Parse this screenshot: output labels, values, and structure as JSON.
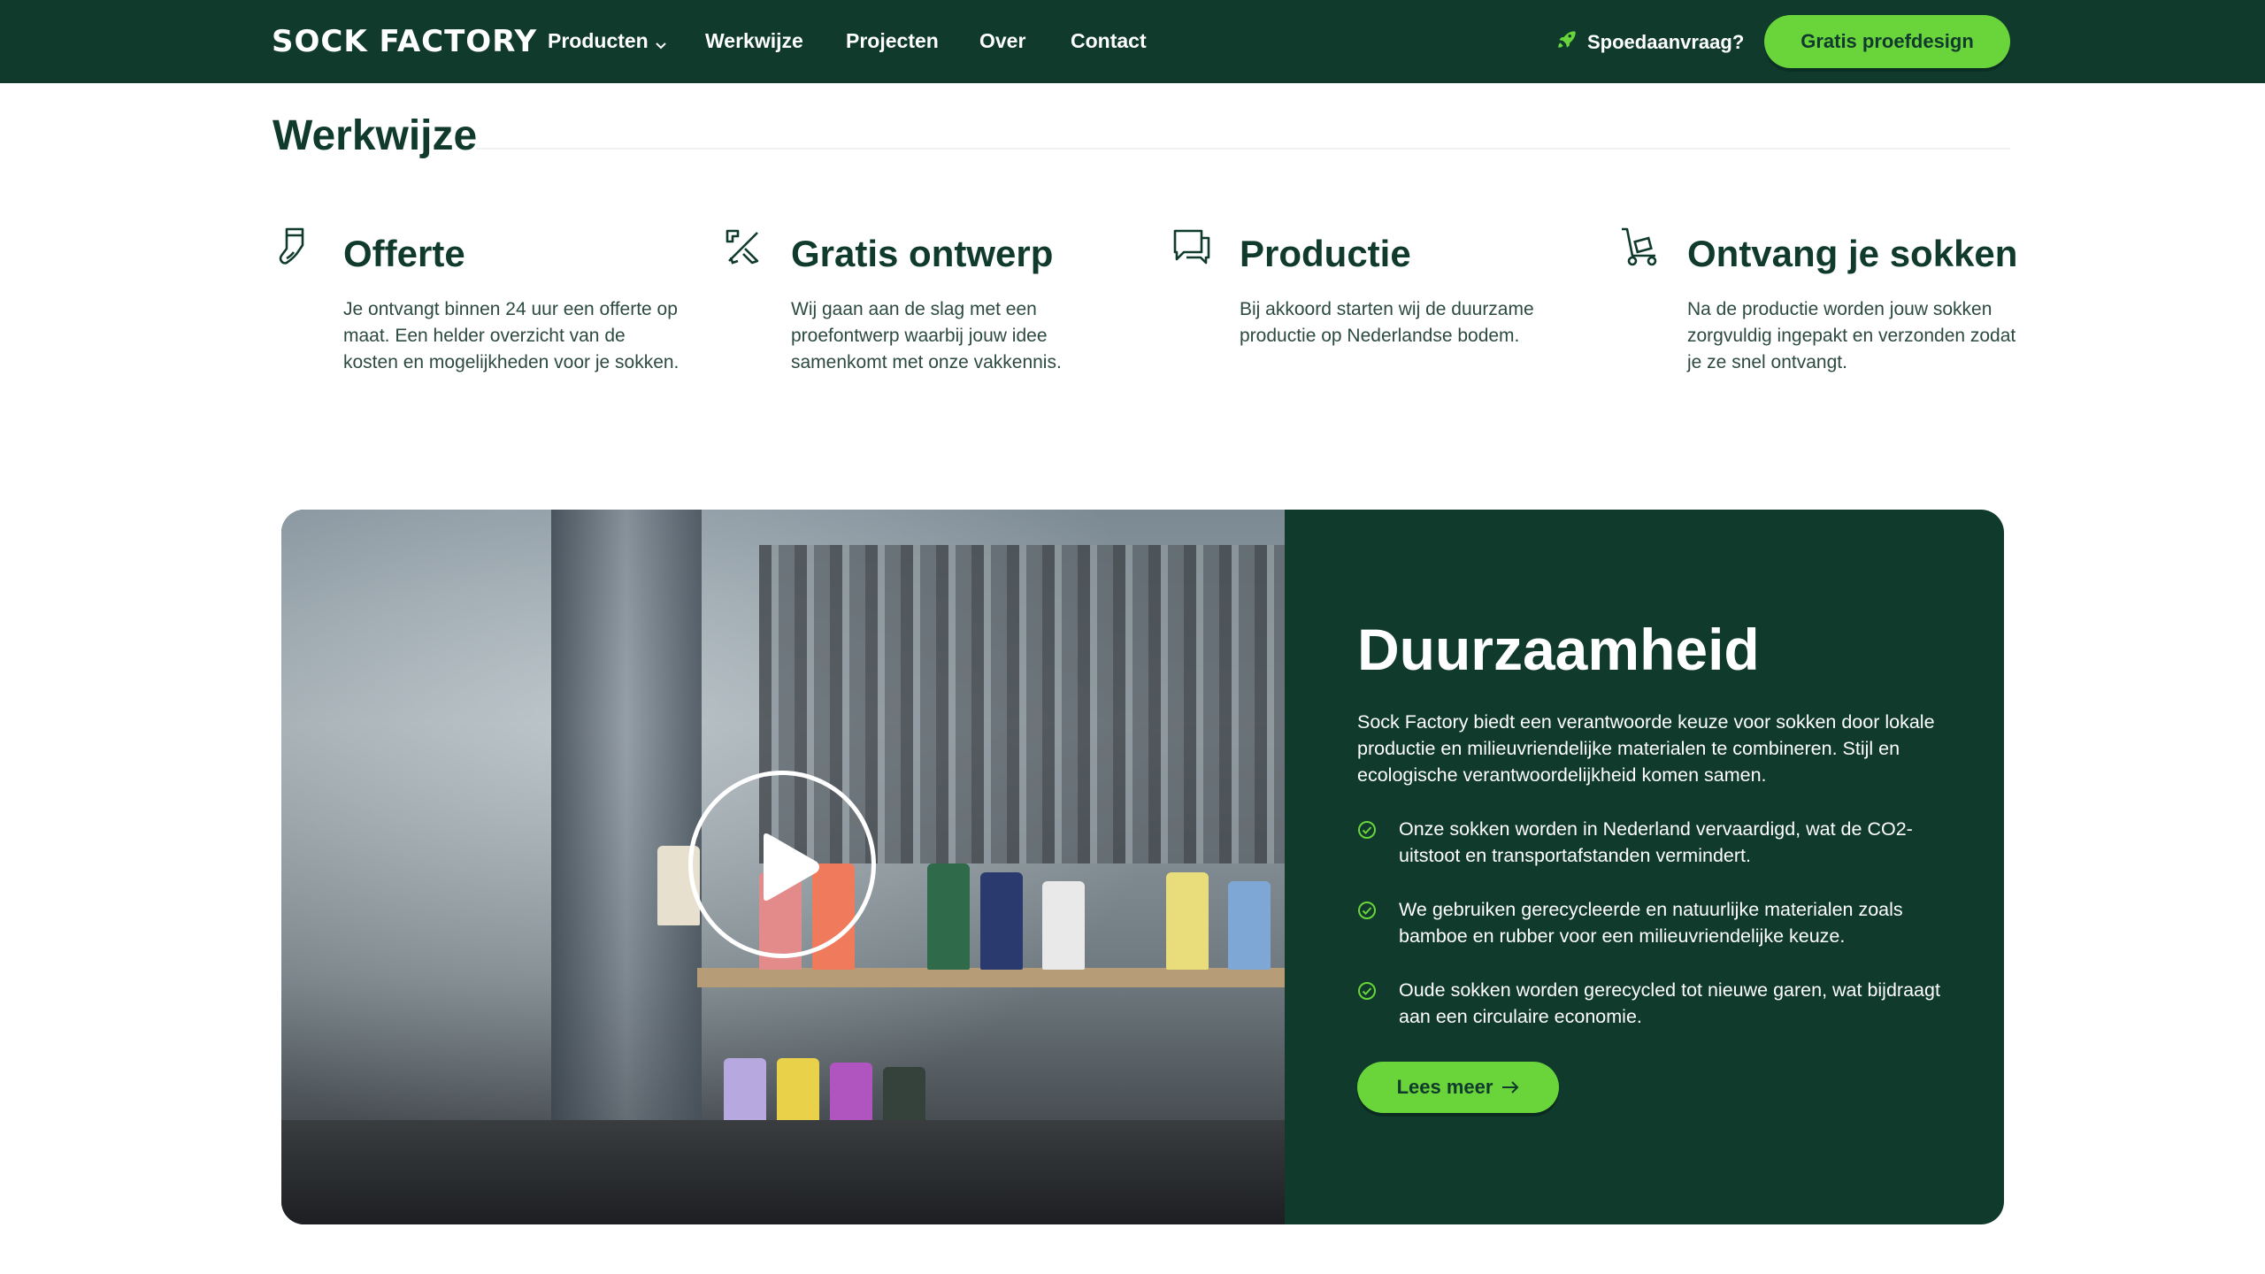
{
  "brand": {
    "logo": "SOCK FACTORY"
  },
  "nav": {
    "links": [
      {
        "label": "Producten"
      },
      {
        "label": "Werkwijze"
      },
      {
        "label": "Projecten"
      },
      {
        "label": "Over"
      },
      {
        "label": "Contact"
      }
    ],
    "speed_label": "Spoedaanvraag?",
    "cta_label": "Gratis proefdesign"
  },
  "werkwijze": {
    "title": "Werkwijze",
    "steps": [
      {
        "icon": "sock-icon",
        "title": "Offerte",
        "text": "Je ontvangt binnen 24 uur een offerte op maat. Een helder overzicht van de kosten en mogelijkheden voor je sokken."
      },
      {
        "icon": "design-tools-icon",
        "title": "Gratis ontwerp",
        "text": "Wij gaan aan de slag met een proefontwerp waarbij jouw idee samenkomt met onze vakkennis."
      },
      {
        "icon": "chat-icon",
        "title": "Productie",
        "text": "Bij akkoord starten wij de duurzame productie op Nederlandse bodem."
      },
      {
        "icon": "hand-truck-icon",
        "title": "Ontvang je sokken",
        "text": "Na de productie worden jouw sokken zorgvuldig ingepakt en verzonden zodat je ze snel ontvangt."
      }
    ]
  },
  "duurzaamheid": {
    "title": "Duurzaamheid",
    "intro": "Sock Factory biedt een verantwoorde keuze voor sokken door lokale productie en milieuvriendelijke materialen te combineren. Stijl en ecologische verantwoordelijkheid komen samen.",
    "bullets": [
      "Onze sokken worden in Nederland vervaardigd, wat de CO2-uitstoot en transportafstanden vermindert.",
      "We gebruiken gerecycleerde en natuurlijke materialen zoals bamboe en rubber voor een milieuvriendelijke keuze.",
      "Oude sokken worden gerecycled tot nieuwe garen, wat bijdraagt aan een circulaire economie."
    ],
    "button_label": "Lees meer"
  },
  "colors": {
    "primary": "#0f3a2c",
    "accent": "#6ad53b",
    "white": "#ffffff"
  }
}
